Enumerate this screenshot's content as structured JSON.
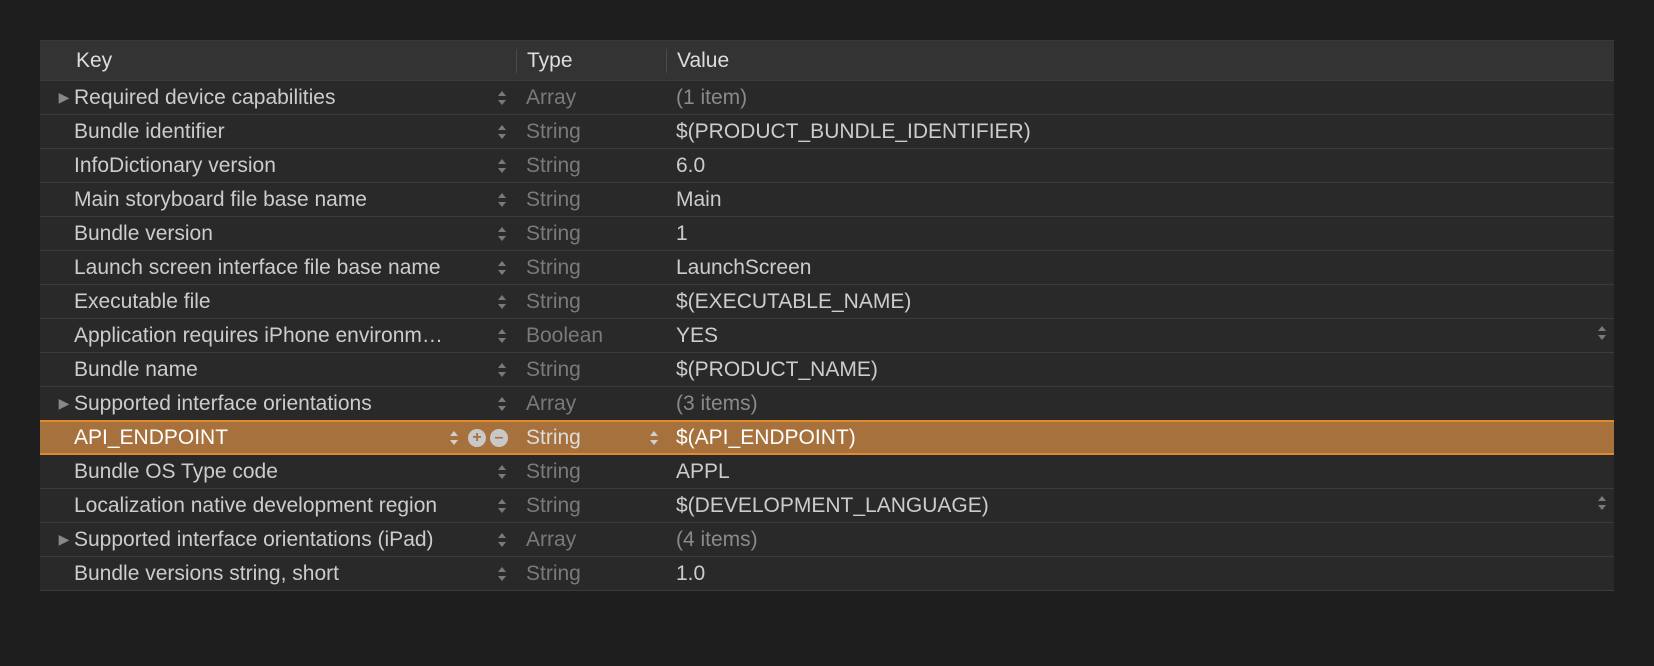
{
  "header": {
    "key": "Key",
    "type": "Type",
    "value": "Value"
  },
  "rows": [
    {
      "expander": "▶",
      "key": "Required device capabilities",
      "type": "Array",
      "value": "(1 item)",
      "dimValue": true,
      "selected": false,
      "extraRightStepper": false,
      "indent": 0
    },
    {
      "expander": "",
      "key": "Bundle identifier",
      "type": "String",
      "value": "$(PRODUCT_BUNDLE_IDENTIFIER)",
      "dimValue": false,
      "selected": false,
      "extraRightStepper": false,
      "indent": 0
    },
    {
      "expander": "",
      "key": "InfoDictionary version",
      "type": "String",
      "value": "6.0",
      "dimValue": false,
      "selected": false,
      "extraRightStepper": false,
      "indent": 0
    },
    {
      "expander": "",
      "key": "Main storyboard file base name",
      "type": "String",
      "value": "Main",
      "dimValue": false,
      "selected": false,
      "extraRightStepper": false,
      "indent": 0
    },
    {
      "expander": "",
      "key": "Bundle version",
      "type": "String",
      "value": "1",
      "dimValue": false,
      "selected": false,
      "extraRightStepper": false,
      "indent": 0
    },
    {
      "expander": "",
      "key": "Launch screen interface file base name",
      "type": "String",
      "value": "LaunchScreen",
      "dimValue": false,
      "selected": false,
      "extraRightStepper": false,
      "indent": 0
    },
    {
      "expander": "",
      "key": "Executable file",
      "type": "String",
      "value": "$(EXECUTABLE_NAME)",
      "dimValue": false,
      "selected": false,
      "extraRightStepper": false,
      "indent": 0
    },
    {
      "expander": "",
      "key": "Application requires iPhone environm…",
      "type": "Boolean",
      "value": "YES",
      "dimValue": false,
      "selected": false,
      "extraRightStepper": true,
      "indent": 0
    },
    {
      "expander": "",
      "key": "Bundle name",
      "type": "String",
      "value": "$(PRODUCT_NAME)",
      "dimValue": false,
      "selected": false,
      "extraRightStepper": false,
      "indent": 0
    },
    {
      "expander": "▶",
      "key": "Supported interface orientations",
      "type": "Array",
      "value": "(3 items)",
      "dimValue": true,
      "selected": false,
      "extraRightStepper": false,
      "indent": 0
    },
    {
      "expander": "",
      "key": "API_ENDPOINT",
      "type": "String",
      "value": "$(API_ENDPOINT)",
      "dimValue": false,
      "selected": true,
      "extraRightStepper": false,
      "indent": 0
    },
    {
      "expander": "",
      "key": "Bundle OS Type code",
      "type": "String",
      "value": "APPL",
      "dimValue": false,
      "selected": false,
      "extraRightStepper": false,
      "indent": 0
    },
    {
      "expander": "",
      "key": "Localization native development region",
      "type": "String",
      "value": "$(DEVELOPMENT_LANGUAGE)",
      "dimValue": false,
      "selected": false,
      "extraRightStepper": true,
      "indent": 0
    },
    {
      "expander": "▶",
      "key": "Supported interface orientations (iPad)",
      "type": "Array",
      "value": "(4 items)",
      "dimValue": true,
      "selected": false,
      "extraRightStepper": false,
      "indent": 0
    },
    {
      "expander": "",
      "key": "Bundle versions string, short",
      "type": "String",
      "value": "1.0",
      "dimValue": false,
      "selected": false,
      "extraRightStepper": false,
      "indent": 0
    }
  ]
}
